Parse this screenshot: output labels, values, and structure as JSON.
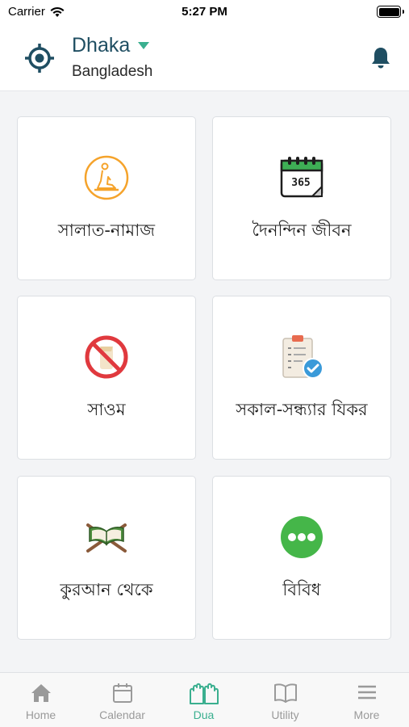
{
  "status": {
    "carrier": "Carrier",
    "time": "5:27 PM"
  },
  "header": {
    "city": "Dhaka",
    "country": "Bangladesh"
  },
  "colors": {
    "primary": "#1f4e62",
    "accent": "#3aaf8f",
    "orange": "#f5a32b",
    "red": "#e0393e",
    "green": "#45b649"
  },
  "categories": [
    {
      "label": "সালাত-নামাজ",
      "icon": "prayer-person-icon"
    },
    {
      "label": "দৈনন্দিন জীবন",
      "icon": "calendar-365-icon"
    },
    {
      "label": "সাওম",
      "icon": "no-food-icon"
    },
    {
      "label": "সকাল-সন্ধ্যার যিকর",
      "icon": "checklist-icon"
    },
    {
      "label": "কুরআন থেকে",
      "icon": "quran-book-icon"
    },
    {
      "label": "বিবিধ",
      "icon": "more-dots-icon"
    }
  ],
  "tabs": [
    {
      "label": "Home",
      "icon": "home-icon",
      "active": false
    },
    {
      "label": "Calendar",
      "icon": "calendar-icon",
      "active": false
    },
    {
      "label": "Dua",
      "icon": "dua-hands-icon",
      "active": true
    },
    {
      "label": "Utility",
      "icon": "book-icon",
      "active": false
    },
    {
      "label": "More",
      "icon": "menu-icon",
      "active": false
    }
  ]
}
